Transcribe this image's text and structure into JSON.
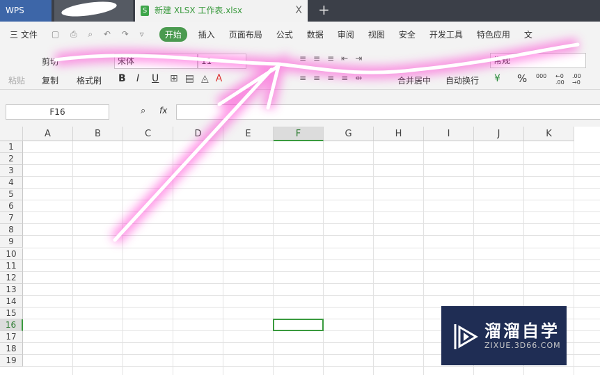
{
  "titlebar": {
    "app": "WPS",
    "doc_tab": "新建 XLSX 工作表.xlsx",
    "doc_icon": "S",
    "close": "X",
    "new_tab": "+"
  },
  "menu": {
    "file": "三 文件",
    "tabs": [
      "开始",
      "插入",
      "页面布局",
      "公式",
      "数据",
      "审阅",
      "视图",
      "安全",
      "开发工具",
      "特色应用",
      "文"
    ]
  },
  "ribbon": {
    "paste": "粘贴",
    "cut": "剪切",
    "copy": "复制",
    "format_painter": "格式刷",
    "font": "宋体",
    "size": "11",
    "bold": "B",
    "italic": "I",
    "underline": "U",
    "merge": "合并居中",
    "wrap": "自动换行",
    "number_format": "常规",
    "currency": "¥",
    "percent": "%",
    "inc": "000",
    "dec1": "←0 .00",
    "dec2": ".00 →0"
  },
  "formula": {
    "cell_ref": "F16",
    "fx": "fx",
    "value": ""
  },
  "columns": [
    "A",
    "B",
    "C",
    "D",
    "E",
    "F",
    "G",
    "H",
    "I",
    "J",
    "K"
  ],
  "rows": [
    "1",
    "2",
    "3",
    "4",
    "5",
    "6",
    "7",
    "8",
    "9",
    "10",
    "11",
    "12",
    "13",
    "14",
    "15",
    "16",
    "17",
    "18",
    "19"
  ],
  "selected": {
    "col": "F",
    "row": "16"
  },
  "watermark": {
    "title": "溜溜自学",
    "url": "ZIXUE.3D66.COM"
  }
}
